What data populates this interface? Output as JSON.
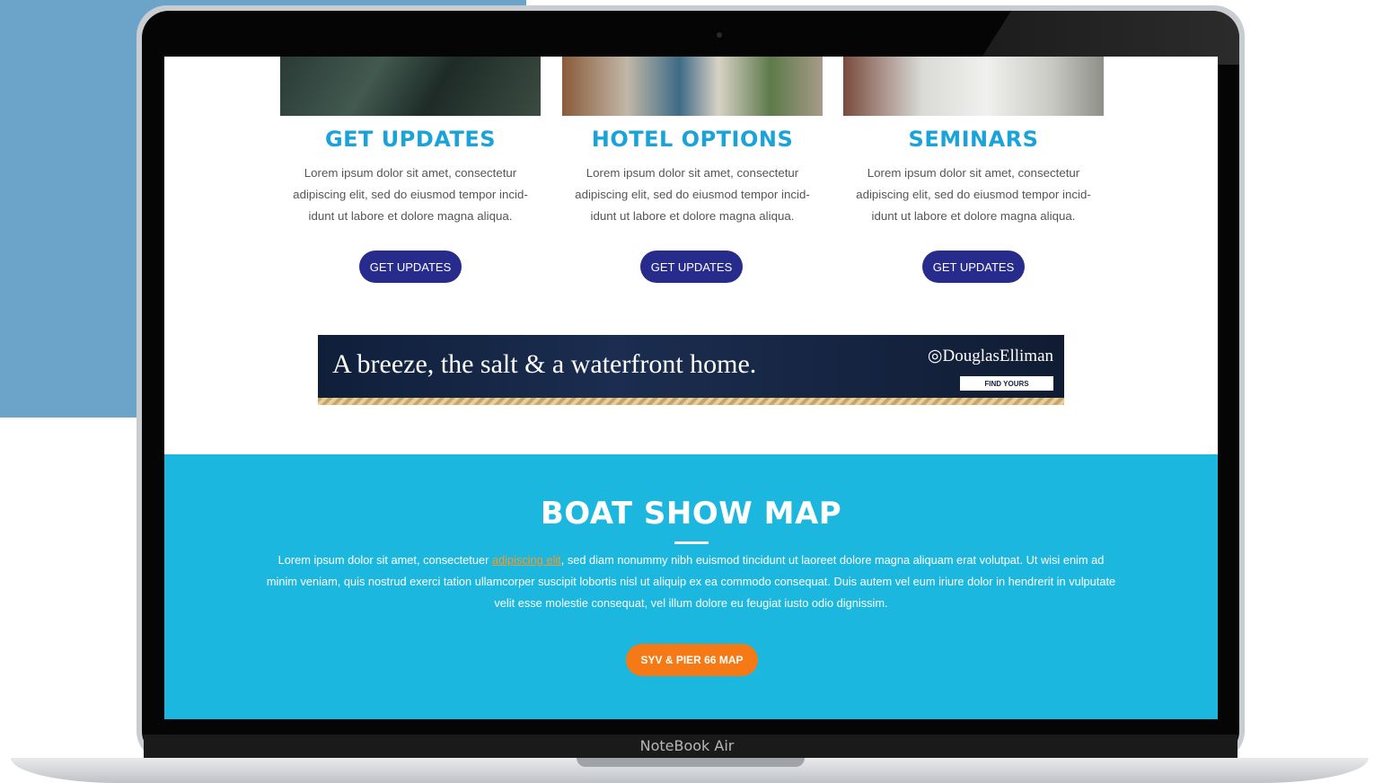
{
  "cards": [
    {
      "title": "GET UPDATES",
      "body": "Lorem ipsum dolor sit amet, consectetur adipiscing elit, sed do eiusmod tempor incid-idunt ut labore et dolore magna aliqua.",
      "button": "GET UPDATES",
      "photo": "marina-aerial-photo"
    },
    {
      "title": "HOTEL OPTIONS",
      "body": "Lorem ipsum dolor sit amet, consectetur adipiscing elit, sed do eiusmod tempor incid-idunt ut labore et dolore magna aliqua.",
      "button": "GET UPDATES",
      "photo": "boardwalk-crowd-photo"
    },
    {
      "title": "SEMINARS",
      "body": "Lorem ipsum dolor sit amet, consectetur adipiscing elit, sed do eiusmod tempor incid-idunt ut labore et dolore magna aliqua.",
      "button": "GET UPDATES",
      "photo": "seminar-seating-photo"
    }
  ],
  "banner": {
    "tagline": "A breeze, the salt & a waterfront home.",
    "brand": "DouglasElliman",
    "cta": "FIND YOURS"
  },
  "map_section": {
    "title": "BOAT SHOW MAP",
    "text_before": "Lorem ipsum dolor sit amet, consectetuer ",
    "link": "adipiscing elit",
    "text_after": ", sed diam nonummy nibh euismod tincidunt ut laoreet dolore magna aliquam erat volutpat. Ut wisi enim ad minim veniam, quis nostrud exerci tation ullamcorper suscipit lobortis nisl ut aliquip ex ea commodo consequat. Duis autem vel eum iriure dolor in hendrerit in vulputate velit esse molestie consequat, vel illum dolore eu feugiat iusto odio dignissim.",
    "button": "SYV & PIER 66 MAP"
  },
  "device": {
    "label": "NoteBook Air"
  },
  "colors": {
    "accent_blue": "#1aa3d9",
    "button_navy": "#272c8c",
    "map_bg": "#1cb7df",
    "map_button": "#f57a16",
    "background_block": "#6ca3c8"
  }
}
